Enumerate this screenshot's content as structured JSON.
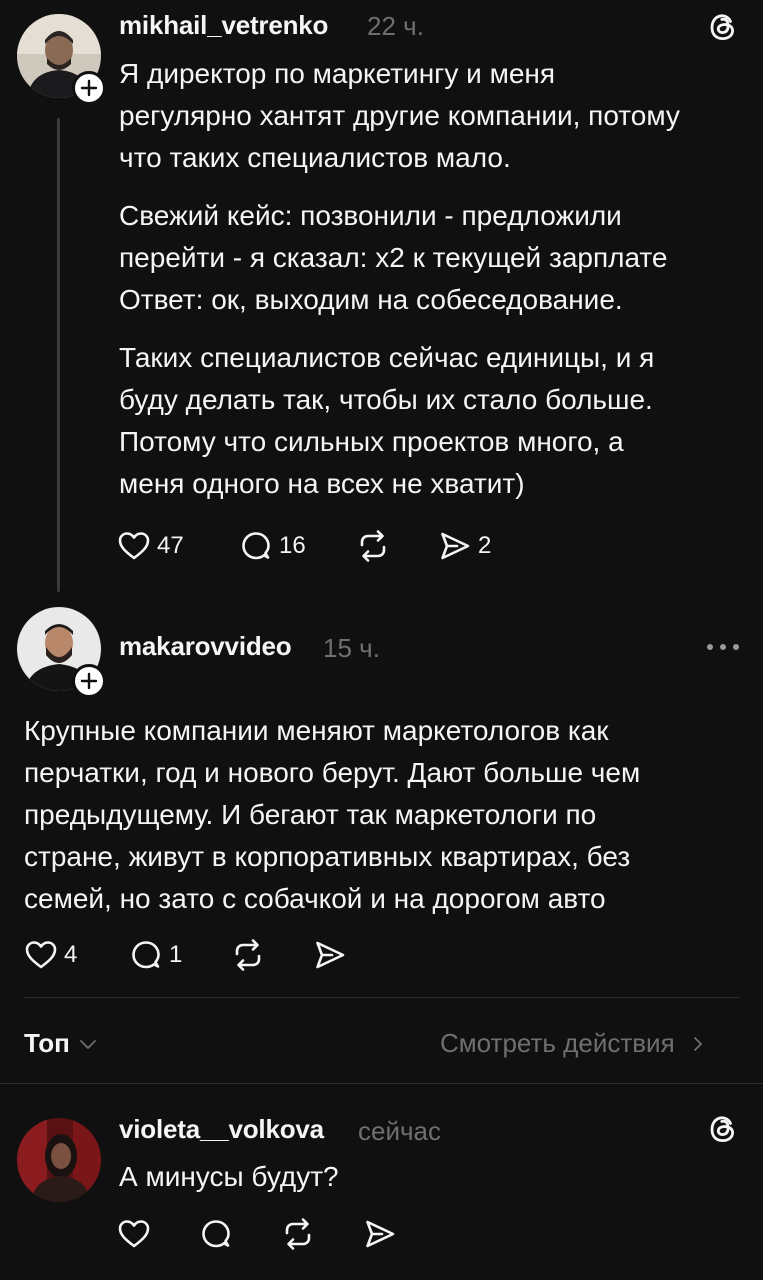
{
  "posts": [
    {
      "username": "mikhail_vetrenko",
      "time": "22 ч.",
      "paragraphs": [
        [
          "Я директор по маркетингу и меня",
          "регулярно хантят другие компании, потому",
          "что таких специалистов мало."
        ],
        [
          "Свежий кейс: позвонили - предложили",
          "перейти - я сказал: х2 к текущей зарплате",
          "Ответ: ок, выходим на собеседование."
        ],
        [
          "Таких специалистов сейчас единицы, и я",
          "буду делать так, чтобы их стало больше.",
          "Потому что сильных проектов много, а",
          "меня одного на всех не хватит)"
        ]
      ],
      "likes": "47",
      "comments": "16",
      "shares": "2"
    },
    {
      "username": "makarovvideo",
      "time": "15 ч.",
      "lines": [
        "Крупные компании меняют маркетологов как",
        "перчатки, год и нового берут. Дают больше чем",
        "предыдущему. И бегают так маркетологи по",
        "стране, живут в корпоративных квартирах, без",
        "семей, но зато с собачкой и на дорогом авто"
      ],
      "likes": "4",
      "comments": "1"
    },
    {
      "username": "violeta__volkova",
      "time": "сейчас",
      "lines": [
        "А минусы будут?"
      ]
    }
  ],
  "sort": {
    "label": "Топ"
  },
  "activity": {
    "label": "Смотреть действия"
  },
  "colors": {
    "background": "#101010",
    "text": "#f3f5f7",
    "muted": "#6f6f6f",
    "divider": "#2a2a2a"
  },
  "icons": [
    "heart-icon",
    "comment-icon",
    "repost-icon",
    "share-icon",
    "threads-icon",
    "more-icon",
    "plus-icon",
    "chevron-down-icon",
    "chevron-right-icon"
  ]
}
